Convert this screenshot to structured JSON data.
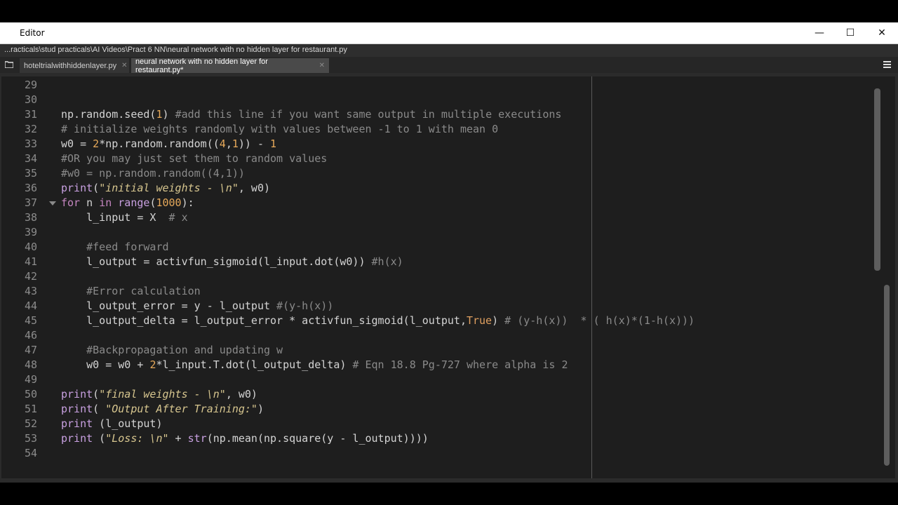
{
  "window": {
    "title": "Editor",
    "controls": {
      "minimize": "—",
      "maximize": "☐",
      "close": "✕"
    }
  },
  "path": "...racticals\\stud practicals\\AI Videos\\Pract 6 NN\\neural network with no hidden layer for restaurant.py",
  "tabs": [
    {
      "label": "hoteltrialwithhiddenlayer.py",
      "close": "✕",
      "active": false
    },
    {
      "label": "neural network with no hidden layer for restaurant.py*",
      "close": "✕",
      "active": true
    }
  ],
  "editor": {
    "line_numbers": [
      "29",
      "30",
      "31",
      "32",
      "33",
      "34",
      "35",
      "36",
      "37",
      "38",
      "39",
      "40",
      "41",
      "42",
      "43",
      "44",
      "45",
      "46",
      "47",
      "48",
      "49",
      "50",
      "51",
      "52",
      "53",
      "54"
    ],
    "lines": [
      "",
      "",
      "np.random.seed(1) #add this line if you want same output in multiple executions",
      "# initialize weights randomly with values between -1 to 1 with mean 0",
      "w0 = 2*np.random.random((4,1)) - 1",
      "#OR you may just set them to random values",
      "#w0 = np.random.random((4,1))",
      "print(\"initial weights - \\n\", w0)",
      "for n in range(1000):",
      "    l_input = X  # x",
      "",
      "    #feed forward",
      "    l_output = activfun_sigmoid(l_input.dot(w0)) #h(x)",
      "",
      "    #Error calculation",
      "    l_output_error = y - l_output #(y-h(x))",
      "    l_output_delta = l_output_error * activfun_sigmoid(l_output,True) # (y-h(x))  * ( h(x)*(1-h(x)))",
      "",
      "    #Backpropagation and updating w",
      "    w0 = w0 + 2*l_input.T.dot(l_output_delta) # Eqn 18.8 Pg-727 where alpha is 2",
      "",
      "print(\"final weights - \\n\", w0)",
      "print( \"Output After Training:\")",
      "print (l_output)",
      "print (\"Loss: \\n\" + str(np.mean(np.square(y - l_output))))",
      ""
    ]
  },
  "colors": {
    "keyword": "#c586c0",
    "number": "#e6a95a",
    "string": "#d7c68f",
    "comment": "#8a8a8a",
    "background": "#1e1e1e"
  }
}
